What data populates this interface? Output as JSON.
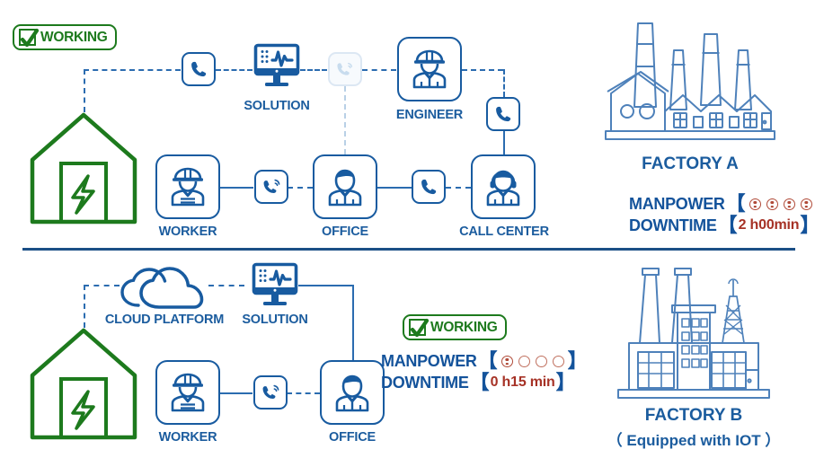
{
  "meta": {
    "accent_blue": "#185ba0",
    "line_blue": "#2b6cb0",
    "green": "#1d7a1d",
    "metric_key_color": "#14539b",
    "metric_value_color": "#a63226",
    "divider_color": "#1b4f86"
  },
  "top_section": {
    "badge": {
      "label": "WORKING",
      "icon": "check-icon"
    },
    "plant_icon": "power-plant-building-icon",
    "nodes": [
      {
        "id": "phone-1",
        "icon": "phone-icon",
        "label": ""
      },
      {
        "id": "solution",
        "icon": "monitor-waveform-icon",
        "label": "SOLUTION"
      },
      {
        "id": "phone-ghost",
        "icon": "phone-signal-icon",
        "label": ""
      },
      {
        "id": "engineer",
        "icon": "engineer-hardhat-icon",
        "label": "ENGINEER"
      },
      {
        "id": "phone-2",
        "icon": "phone-icon",
        "label": ""
      },
      {
        "id": "worker",
        "icon": "worker-hardhat-icon",
        "label": "WORKER"
      },
      {
        "id": "phone-3",
        "icon": "phone-signal-icon",
        "label": ""
      },
      {
        "id": "office",
        "icon": "office-person-icon",
        "label": "OFFICE"
      },
      {
        "id": "phone-4",
        "icon": "phone-icon",
        "label": ""
      },
      {
        "id": "callcenter",
        "icon": "headset-person-icon",
        "label": "CALL CENTER"
      }
    ],
    "factory": {
      "title": "FACTORY A",
      "icon": "old-factory-icon",
      "metrics": [
        {
          "key": "MANPOWER",
          "open": "【",
          "close": "】",
          "pips_total": 4,
          "pips_filled": 4,
          "value": ""
        },
        {
          "key": "DOWNTIME",
          "open": "【",
          "close": "】",
          "value": "2 h00min"
        }
      ]
    }
  },
  "bottom_section": {
    "badge": {
      "label": "WORKING",
      "icon": "check-icon"
    },
    "plant_icon": "power-plant-building-icon",
    "nodes": [
      {
        "id": "cloud",
        "icon": "cloud-icon",
        "label": "CLOUD PLATFORM"
      },
      {
        "id": "solution",
        "icon": "monitor-waveform-icon",
        "label": "SOLUTION"
      },
      {
        "id": "worker",
        "icon": "worker-hardhat-icon",
        "label": "WORKER"
      },
      {
        "id": "phone-1",
        "icon": "phone-signal-icon",
        "label": ""
      },
      {
        "id": "office",
        "icon": "office-person-icon",
        "label": "OFFICE"
      }
    ],
    "factory": {
      "title": "FACTORY B",
      "subtitle": "（ Equipped with IOT ）",
      "icon": "modern-factory-iot-icon",
      "metrics": [
        {
          "key": "MANPOWER",
          "open": "【",
          "close": "】",
          "pips_total": 4,
          "pips_filled": 1,
          "value": ""
        },
        {
          "key": "DOWNTIME",
          "open": "【",
          "close": "】",
          "value": "0 h15 min"
        }
      ]
    }
  }
}
